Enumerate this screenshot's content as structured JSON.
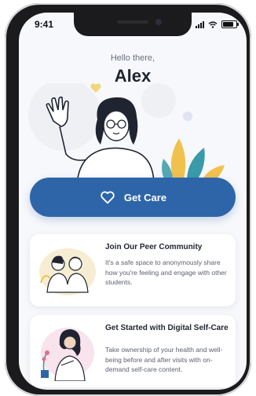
{
  "status_bar": {
    "time": "9:41"
  },
  "home": {
    "greeting": "Hello there,",
    "user_name": "Alex",
    "cta_label": "Get Care"
  },
  "cards": [
    {
      "title": "Join Our Peer Community",
      "description": "It's a safe space to anonymously share how you're feeling and engage with other students."
    },
    {
      "title": "Get Started with Digital Self-Care",
      "description": "Take ownership of your health and well-being before and after visits with on-demand self-care content."
    }
  ],
  "colors": {
    "primary": "#2e65a9",
    "background": "#f7f8fb",
    "card": "#ffffff",
    "accent_yellow": "#f0c14d",
    "accent_teal": "#3a9aa8"
  },
  "icons": {
    "cta": "heart-icon",
    "status": [
      "signal-icon",
      "wifi-icon",
      "battery-icon"
    ]
  }
}
